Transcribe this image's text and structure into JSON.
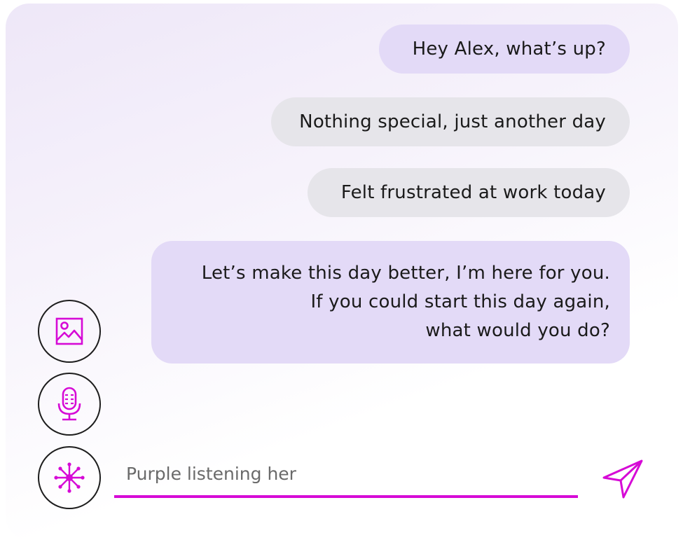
{
  "chat": {
    "messages": [
      {
        "sender": "assistant",
        "text": "Hey Alex, what’s up?"
      },
      {
        "sender": "user",
        "text": "Nothing special, just another day"
      },
      {
        "sender": "user",
        "text": "Felt frustrated at work today"
      },
      {
        "sender": "assistant",
        "lines": [
          "Let’s make this day better, I’m here for you.",
          "If you could start this day again,",
          "what would you do?"
        ]
      }
    ]
  },
  "composer": {
    "placeholder": "Purple listening her",
    "value": ""
  },
  "icons": {
    "image": "image-icon",
    "mic": "microphone-icon",
    "spark": "spark-icon",
    "send": "send-icon"
  },
  "colors": {
    "accent": "#d60ad6",
    "assistant_bubble": "#e3daf7",
    "user_bubble": "#e6e5ea",
    "panel_tint": "#eee7f8"
  }
}
